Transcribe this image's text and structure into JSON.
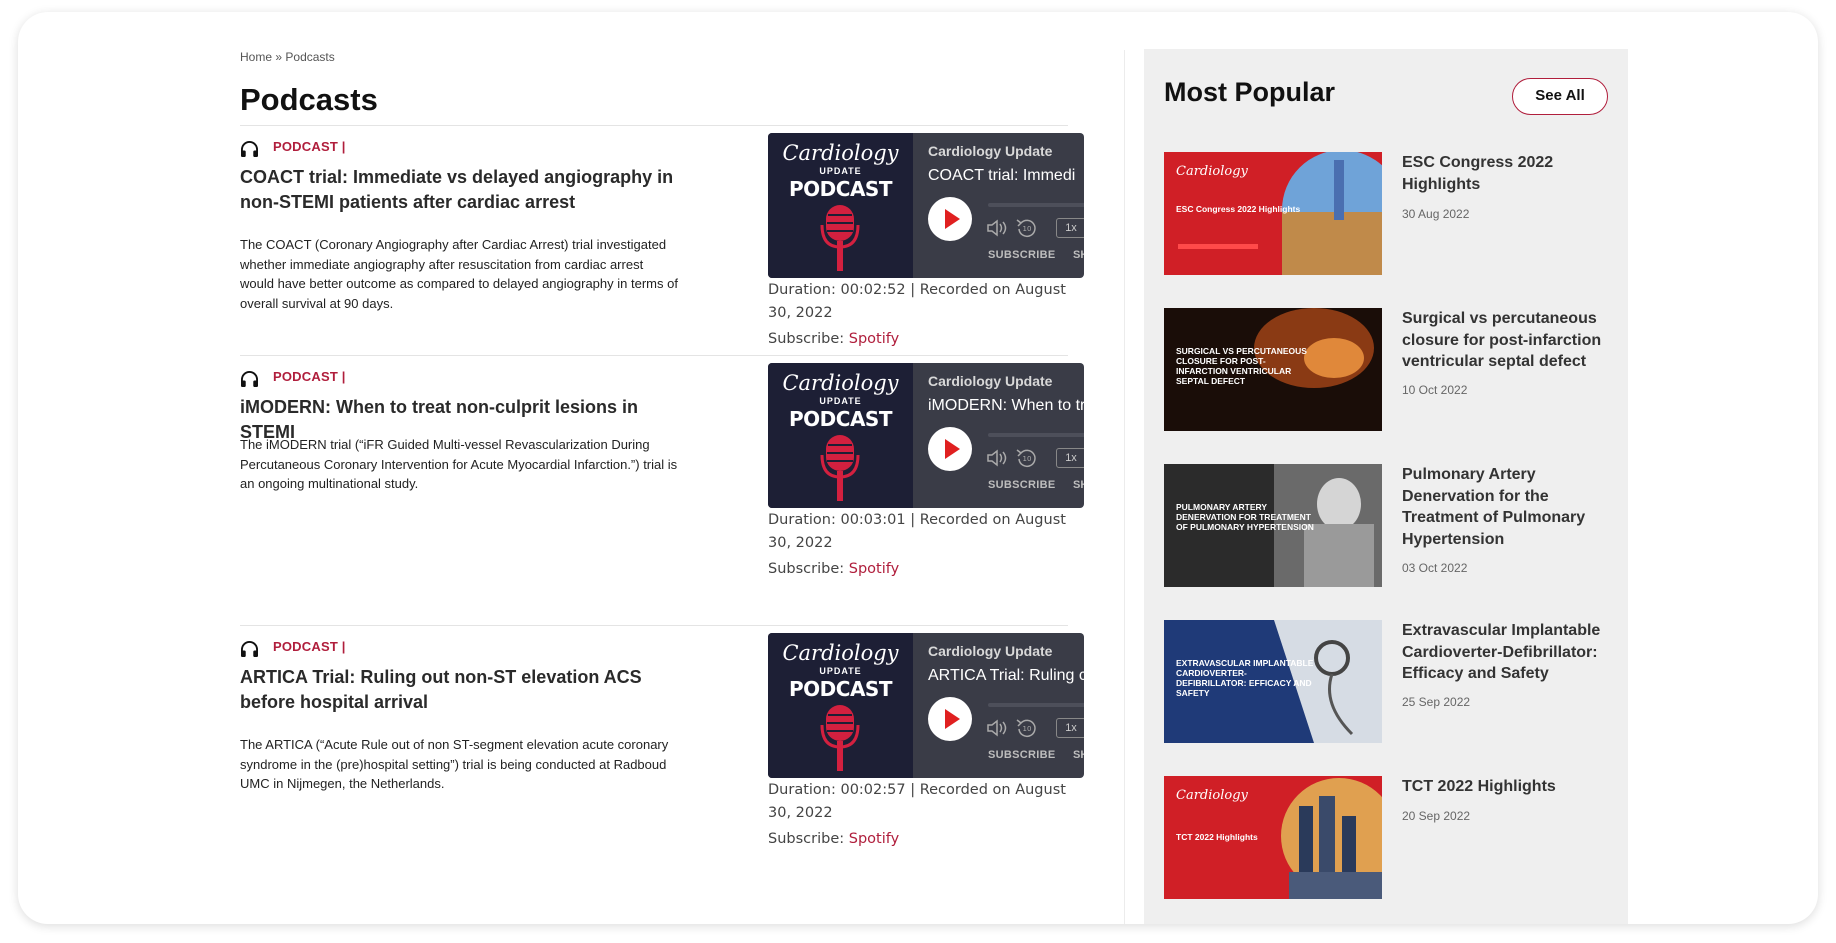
{
  "breadcrumb": {
    "home": "Home",
    "sep": "»",
    "current": "Podcasts"
  },
  "page_title": "Podcasts",
  "podcasts": [
    {
      "tag": "PODCAST",
      "tag_sep": "|",
      "title": "COACT trial: Immediate vs delayed angiography in non-STEMI patients after cardiac arrest",
      "description": "The COACT (Coronary Angiography after Cardiac Arrest) trial investigated whether immediate angiography after resuscitation from cardiac arrest would have better outcome as compared to delayed angiography in terms of overall survival at 90 days.",
      "player": {
        "art_logo": "Cardiology",
        "art_sub": "UPDATE",
        "art_label": "PODCAST",
        "brand": "Cardiology Update",
        "title": "COACT trial: Immedi",
        "speed": "1x",
        "subscribe": "SUBSCRIBE",
        "share": "SH"
      },
      "duration_line": "Duration: 00:02:52 | Recorded on August 30, 2022",
      "subscribe_label": "Subscribe:",
      "subscribe_link": "Spotify"
    },
    {
      "tag": "PODCAST",
      "tag_sep": "|",
      "title": "iMODERN: When to treat non-culprit lesions in STEMI",
      "description": "The iMODERN trial (“iFR Guided Multi-vessel Revascularization During Percutaneous Coronary Intervention for Acute Myocardial Infarction.”) trial is an ongoing multinational study.",
      "player": {
        "art_logo": "Cardiology",
        "art_sub": "UPDATE",
        "art_label": "PODCAST",
        "brand": "Cardiology Update",
        "title": "iMODERN: When to tr",
        "speed": "1x",
        "subscribe": "SUBSCRIBE",
        "share": "SH"
      },
      "duration_line": "Duration: 00:03:01 | Recorded on August 30, 2022",
      "subscribe_label": "Subscribe:",
      "subscribe_link": "Spotify"
    },
    {
      "tag": "PODCAST",
      "tag_sep": "|",
      "title": "ARTICA Trial: Ruling out non-ST elevation ACS before hospital arrival",
      "description": "The ARTICA (“Acute Rule out of non ST-segment elevation acute coronary syndrome in the (pre)hospital setting”) trial is being conducted at Radboud UMC in Nijmegen, the Netherlands.",
      "player": {
        "art_logo": "Cardiology",
        "art_sub": "UPDATE",
        "art_label": "PODCAST",
        "brand": "Cardiology Update",
        "title": "ARTICA Trial: Ruling c",
        "speed": "1x",
        "subscribe": "SUBSCRIBE",
        "share": "SH"
      },
      "duration_line": "Duration: 00:02:57 | Recorded on August 30, 2022",
      "subscribe_label": "Subscribe:",
      "subscribe_link": "Spotify"
    }
  ],
  "sidebar": {
    "title": "Most Popular",
    "see_all": "See All",
    "items": [
      {
        "title": "ESC Congress 2022 Highlights",
        "date": "30 Aug 2022",
        "thumb_text": "ESC Congress 2022 Highlights",
        "thumb_color": "#d01f26"
      },
      {
        "title": "Surgical vs percutaneous closure for post-infarction ventricular septal defect",
        "date": "10 Oct 2022",
        "thumb_text": "SURGICAL VS PERCUTANEOUS CLOSURE FOR POST-INFARCTION VENTRICULAR SEPTAL DEFECT",
        "thumb_color": "#1a0d08"
      },
      {
        "title": "Pulmonary Artery Denervation for the Treatment of Pulmonary Hypertension",
        "date": "03 Oct 2022",
        "thumb_text": "PULMONARY ARTERY DENERVATION FOR TREATMENT OF PULMONARY HYPERTENSION",
        "thumb_color": "#2b2b2b"
      },
      {
        "title": "Extravascular Implantable Cardioverter-Defibrillator: Efficacy and Safety",
        "date": "25 Sep 2022",
        "thumb_text": "EXTRAVASCULAR IMPLANTABLE CARDIOVERTER-DEFIBRILLATOR: EFFICACY AND SAFETY",
        "thumb_color": "#1f3a78"
      },
      {
        "title": "TCT 2022 Highlights",
        "date": "20 Sep 2022",
        "thumb_text": "TCT 2022 Highlights",
        "thumb_color": "#d01f26"
      }
    ]
  },
  "icons": {
    "tag_icon": "headphones-icon",
    "player_play": "play-icon",
    "player_volume": "volume-icon",
    "player_rewind": "rewind-10-icon",
    "art_mic": "microphone-icon"
  },
  "colors": {
    "accent": "#b01e3c",
    "player_bg": "#3a3c47",
    "art_bg": "#1d1f35",
    "sidebar_bg": "#efefef"
  }
}
